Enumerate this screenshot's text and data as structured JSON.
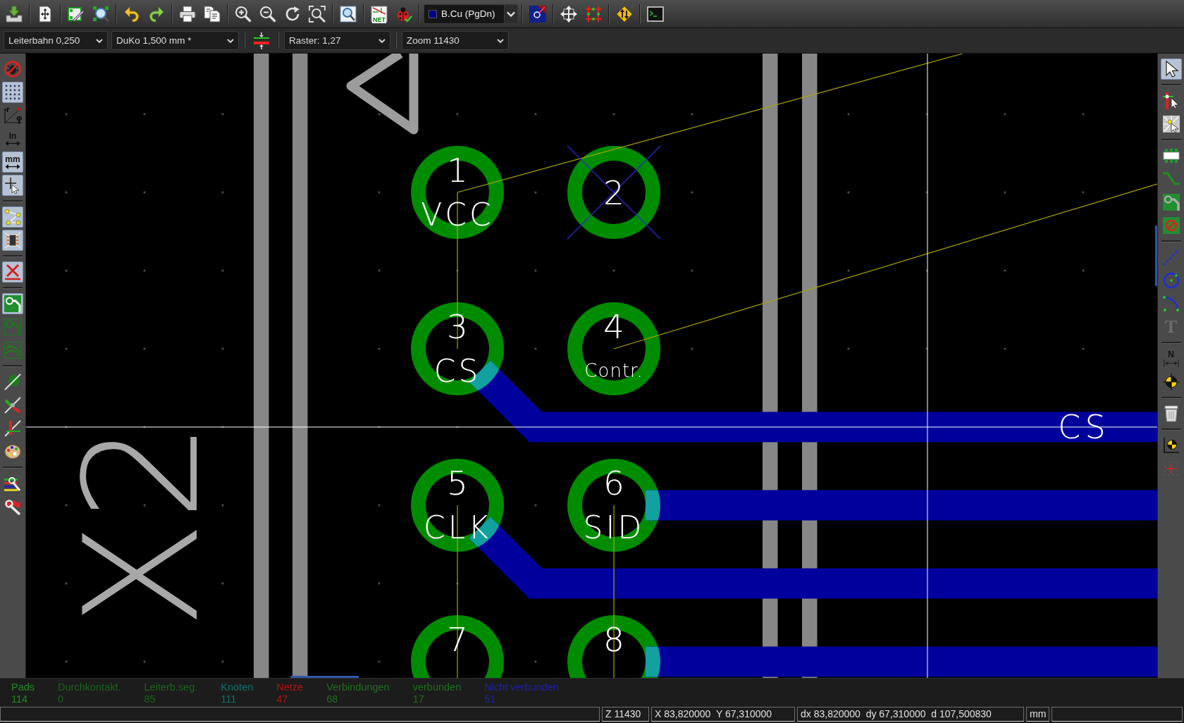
{
  "main_toolbar": {
    "netlist_label": "NET",
    "layer_select": "B.Cu (PgDn)"
  },
  "options_toolbar": {
    "selects": [
      {
        "value": "Leiterbahn 0,250"
      },
      {
        "value": "DuKo 1,500 mm *"
      },
      {
        "value": "Raster: 1,27"
      },
      {
        "value": "Zoom 11430"
      }
    ]
  },
  "left_toolbar": {
    "groups": [
      {
        "items": [
          {
            "on": false
          },
          {
            "on": true
          },
          {
            "on": false,
            "labels": [
              "r",
              "φ"
            ]
          },
          {
            "on": false,
            "label": "In"
          },
          {
            "on": true,
            "label": "mm"
          },
          {
            "on": true
          }
        ]
      },
      {
        "items": [
          {
            "on": true
          },
          {
            "on": true
          }
        ]
      },
      {
        "items": [
          {
            "on": true
          }
        ]
      },
      {
        "items": [
          {
            "on": true
          },
          {
            "on": false
          },
          {
            "on": false
          }
        ]
      },
      {
        "items": [
          {
            "on": false
          },
          {
            "on": false
          },
          {
            "on": false
          },
          {
            "on": false
          }
        ]
      },
      {
        "items": [
          {
            "on": false
          },
          {
            "on": false
          }
        ]
      }
    ]
  },
  "right_toolbar": {
    "groups": [
      {
        "items": [
          {
            "selected": true
          }
        ]
      },
      {
        "items": [
          {
            "selected": false
          },
          {
            "selected": false
          }
        ]
      },
      {
        "items": [
          {
            "selected": false
          },
          {
            "selected": false
          },
          {
            "selected": false
          },
          {
            "selected": false
          }
        ]
      },
      {
        "items": [
          {
            "selected": false
          },
          {
            "selected": false
          },
          {
            "selected": false
          },
          {
            "selected": false,
            "label": "T"
          }
        ]
      },
      {
        "items": [
          {
            "selected": false,
            "label": "N"
          },
          {
            "selected": false
          }
        ]
      },
      {
        "items": [
          {
            "selected": false
          }
        ]
      },
      {
        "items": [
          {
            "selected": false
          },
          {
            "selected": false
          }
        ]
      }
    ]
  },
  "canvas": {
    "silkscreen_text": "X2",
    "pads": [
      {
        "number": "1",
        "name": "VCC",
        "no_connect": false
      },
      {
        "number": "2",
        "no_connect": true
      },
      {
        "number": "3",
        "name": "CS",
        "no_connect": false
      },
      {
        "number": "4",
        "name": "Contr.",
        "no_connect": false
      },
      {
        "number": "5",
        "name": "CLK",
        "no_connect": false
      },
      {
        "number": "6",
        "name": "SID",
        "no_connect": false
      },
      {
        "number": "7",
        "no_connect": false
      },
      {
        "number": "8",
        "no_connect": false
      }
    ],
    "net_label": "CS"
  },
  "message_panel": {
    "items": [
      {
        "label": "Pads",
        "value": "114",
        "color": "#1e8a1e"
      },
      {
        "label": "Durchkontakt.",
        "value": "0",
        "color": "#186418"
      },
      {
        "label": "Leiterb.seg.",
        "value": "85",
        "color": "#186418"
      },
      {
        "label": "Knoten",
        "value": "111",
        "color": "#0e7070"
      },
      {
        "label": "Netze",
        "value": "47",
        "color": "#b01212"
      },
      {
        "label": "Verbindungen",
        "value": "68",
        "color": "#1c6e1c"
      },
      {
        "label": "verbunden",
        "value": "17",
        "color": "#1c6e1c"
      },
      {
        "label": "Nicht verbunden",
        "value": "51",
        "color": "#2020a4"
      }
    ]
  },
  "status_bar": {
    "fields": [
      "Z 11430",
      "X 83,820000  Y 67,310000",
      "dx 83,820000  dy 67,310000  d 107,500830",
      "mm"
    ]
  }
}
